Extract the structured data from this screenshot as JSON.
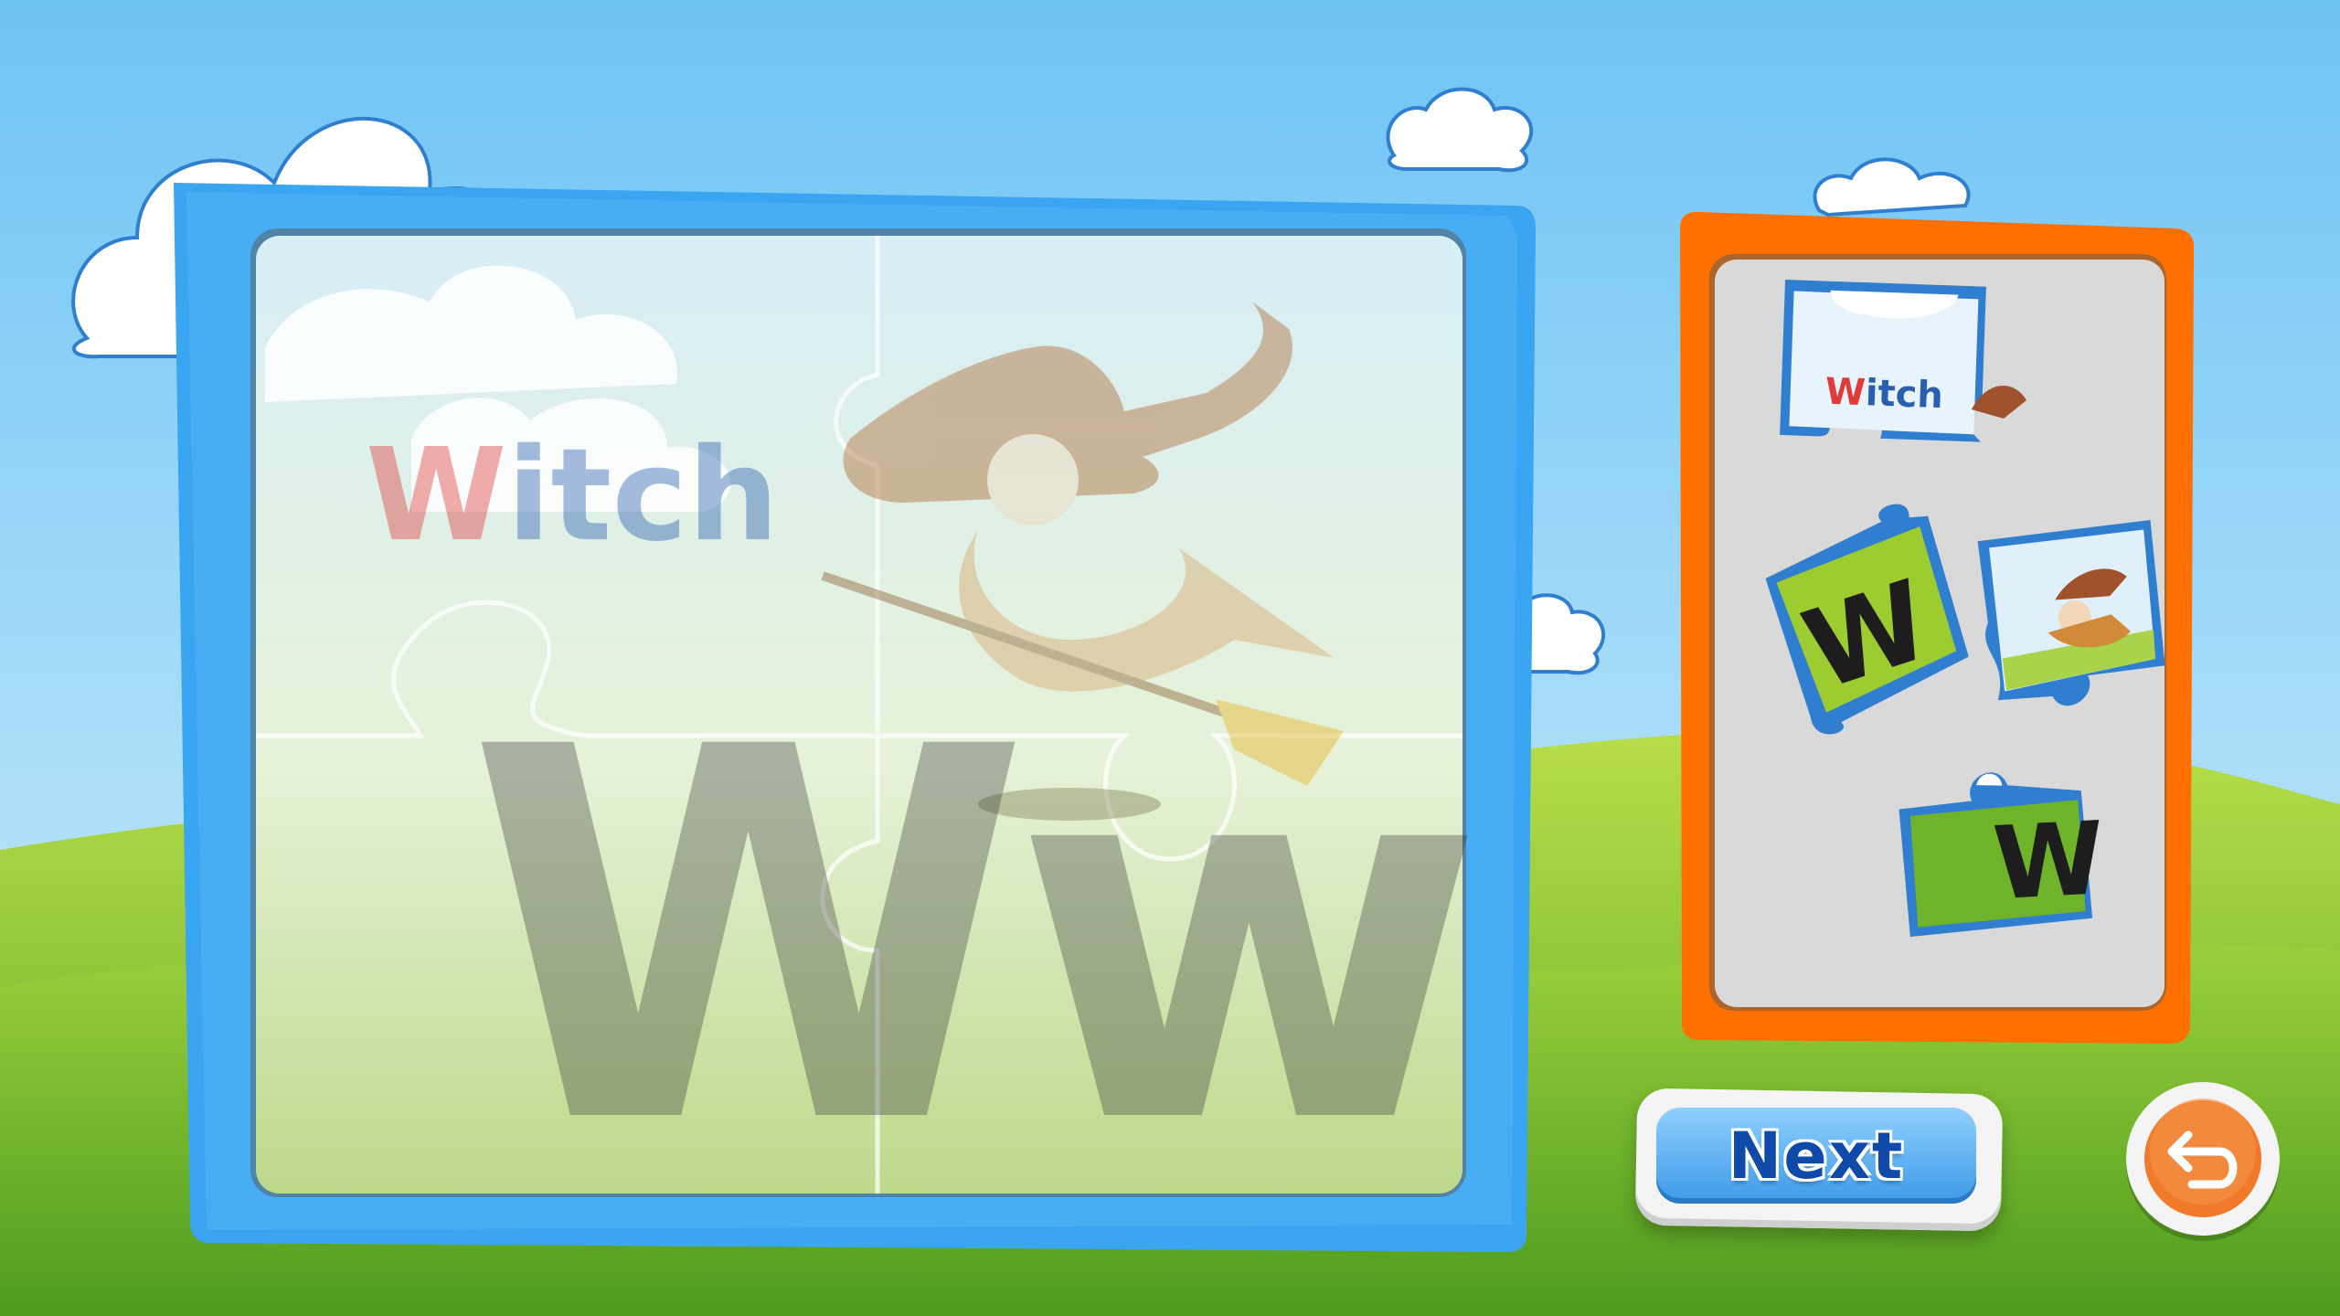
{
  "puzzle": {
    "word": "Witch",
    "word_first_letter": "W",
    "word_rest": "itch",
    "letter_pair": "Ww",
    "letter_upper": "W",
    "letter_lower": "w"
  },
  "tray": {
    "piece_top_word": "Witch",
    "piece_bottom_letters": "W"
  },
  "buttons": {
    "next_label": "Next",
    "back_icon": "undo-arrow-icon"
  },
  "colors": {
    "sky_top": "#6ec3f5",
    "sky_bottom": "#c8ebfb",
    "grass_dark": "#6fb32b",
    "grass_light": "#b8de4a",
    "board_frame": "#3aa5f0",
    "tray_frame": "#ff7000",
    "tray_bg": "#d9d9d9",
    "word_accent": "#e03b3b",
    "word_main": "#2a5fb0",
    "next_button": "#3d9ae8",
    "back_button": "#f07a2a"
  }
}
